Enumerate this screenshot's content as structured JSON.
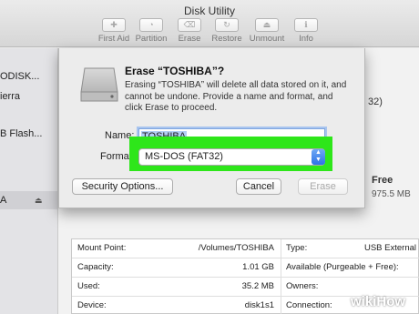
{
  "window": {
    "title": "Disk Utility"
  },
  "toolbar": {
    "items": [
      {
        "label": "First Aid",
        "icon": "first-aid-icon",
        "glyph": "✚"
      },
      {
        "label": "Partition",
        "icon": "partition-icon",
        "glyph": "◔"
      },
      {
        "label": "Erase",
        "icon": "erase-icon",
        "glyph": "⌫"
      },
      {
        "label": "Restore",
        "icon": "restore-icon",
        "glyph": "↻"
      },
      {
        "label": "Unmount",
        "icon": "unmount-icon",
        "glyph": "⏏"
      },
      {
        "label": "Info",
        "icon": "info-icon",
        "glyph": "ℹ"
      }
    ]
  },
  "sidebar": {
    "items": [
      {
        "label": "ODISK..."
      },
      {
        "label": "ierra"
      },
      {
        "label": "B Flash..."
      },
      {
        "label": "A",
        "eject_icon": "eject-icon",
        "selected": true
      }
    ]
  },
  "background": {
    "right_format": "32)",
    "free_label": "Free",
    "free_value": "975.5 MB"
  },
  "info_table": {
    "rows": [
      {
        "label": "Mount Point:",
        "value": "/Volumes/TOSHIBA",
        "label2": "Type:",
        "value2": "USB External"
      },
      {
        "label": "Capacity:",
        "value": "1.01 GB",
        "label2": "Available (Purgeable + Free):",
        "value2": ""
      },
      {
        "label": "Used:",
        "value": "35.2 MB",
        "label2": "Owners:",
        "value2": ""
      },
      {
        "label": "Device:",
        "value": "disk1s1",
        "label2": "Connection:",
        "value2": ""
      }
    ]
  },
  "dialog": {
    "title": "Erase “TOSHIBA”?",
    "message": "Erasing “TOSHIBA” will delete all data stored on it, and cannot be undone. Provide a name and format, and click Erase to proceed.",
    "name_label": "Name:",
    "name_value": "TOSHIBA",
    "format_label": "Format",
    "format_value": "MS-DOS (FAT32)",
    "security_button": "Security Options...",
    "cancel_button": "Cancel",
    "erase_button": "Erase",
    "highlight_color": "#2ee61a"
  },
  "watermark": {
    "prefix": "wiki",
    "suffix": "How"
  }
}
